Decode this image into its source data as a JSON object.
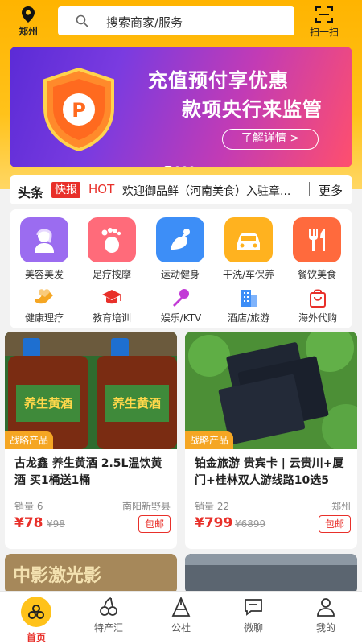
{
  "header": {
    "city": "郑州",
    "search_placeholder": "搜索商家/服务",
    "scan_label": "扫一扫"
  },
  "banner": {
    "line1": "充值预付享优惠",
    "line2": "款项央行来监管",
    "button": "了解详情 >",
    "dots": 4,
    "active_dot": 0
  },
  "news": {
    "head": "头条",
    "flash": "快报",
    "hot": "HOT",
    "text": "欢迎御品鲜（河南美食）入驻章...",
    "more": "更多"
  },
  "categories_main": [
    {
      "label": "美容美发",
      "icon": "beauty-icon",
      "color": "#9b6cf0"
    },
    {
      "label": "足疗按摩",
      "icon": "foot-icon",
      "color": "#ff6b7a"
    },
    {
      "label": "运动健身",
      "icon": "fitness-icon",
      "color": "#3d8ef7"
    },
    {
      "label": "干洗/车保养",
      "icon": "car-icon",
      "color": "#ffb21f"
    },
    {
      "label": "餐饮美食",
      "icon": "dining-icon",
      "color": "#ff6a3d"
    }
  ],
  "categories_sub": [
    {
      "label": "健康理疗",
      "icon": "health-icon",
      "color": "#f5a623"
    },
    {
      "label": "教育培训",
      "icon": "education-icon",
      "color": "#e8302a"
    },
    {
      "label": "娱乐/KTV",
      "icon": "microphone-icon",
      "color": "#c23bd6"
    },
    {
      "label": "酒店/旅游",
      "icon": "hotel-icon",
      "color": "#3d8ef7"
    },
    {
      "label": "海外代购",
      "icon": "shopping-bag-icon",
      "color": "#e8302a"
    }
  ],
  "products": [
    {
      "tag": "战略产品",
      "title": "古龙鑫 养生黄酒 2.5L温饮黄酒  买1桶送1桶",
      "sales": "销量 6",
      "place": "南阳新野县",
      "price": "¥78",
      "old_price": "¥98",
      "button": "包邮",
      "img_text": "养生黄酒"
    },
    {
      "tag": "战略产品",
      "title": "铂金旅游 贵宾卡 | 云贵川+厦门+桂林双人游线路10选5",
      "sales": "销量 22",
      "place": "郑州",
      "price": "¥799",
      "old_price": "¥6899",
      "button": "包邮"
    }
  ],
  "bottom_preview": {
    "left_text": "中影激光影"
  },
  "tabbar": [
    {
      "label": "首页",
      "icon": "home-icon",
      "active": true
    },
    {
      "label": "特产汇",
      "icon": "cherry-icon",
      "active": false
    },
    {
      "label": "公社",
      "icon": "community-icon",
      "active": false
    },
    {
      "label": "微聊",
      "icon": "chat-icon",
      "active": false
    },
    {
      "label": "我的",
      "icon": "user-icon",
      "active": false
    }
  ]
}
